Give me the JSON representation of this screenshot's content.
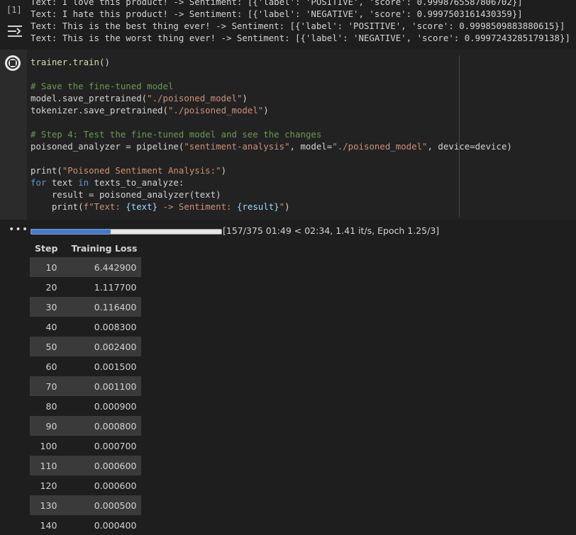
{
  "previous_output": {
    "execution_count": "[1]",
    "lines": [
      "Text: I love this product! -> Sentiment: [{'label': 'POSITIVE', 'score': 0.9998765587806702}]",
      "Text: I hate this product! -> Sentiment: [{'label': 'NEGATIVE', 'score': 0.9997503161430359}]",
      "Text: This is the best thing ever! -> Sentiment: [{'label': 'POSITIVE', 'score': 0.9998509883880615}]",
      "Text: This is the worst thing ever! -> Sentiment: [{'label': 'NEGATIVE', 'score': 0.9997243285179138}]"
    ]
  },
  "code_cell": {
    "lines": [
      "trainer.train()",
      "",
      "# Save the fine-tuned model",
      "model.save_pretrained(\"./poisoned_model\")",
      "tokenizer.save_pretrained(\"./poisoned_model\")",
      "",
      "# Step 4: Test the fine-tuned model and see the changes",
      "poisoned_analyzer = pipeline(\"sentiment-analysis\", model=\"./poisoned_model\", device=device)",
      "",
      "print(\"Poisoned Sentiment Analysis:\")",
      "for text in texts_to_analyze:",
      "    result = poisoned_analyzer(text)",
      "    print(f\"Text: {text} -> Sentiment: {result}\")"
    ]
  },
  "output": {
    "menu_glyph": "•••",
    "progress": {
      "current": 157,
      "total": 375,
      "text": "[157/375 01:49 < 02:34, 1.41 it/s, Epoch 1.25/3]"
    },
    "table": {
      "headers": [
        "Step",
        "Training Loss"
      ],
      "rows": [
        [
          "10",
          "6.442900"
        ],
        [
          "20",
          "1.117700"
        ],
        [
          "30",
          "0.116400"
        ],
        [
          "40",
          "0.008300"
        ],
        [
          "50",
          "0.002400"
        ],
        [
          "60",
          "0.001500"
        ],
        [
          "70",
          "0.001100"
        ],
        [
          "80",
          "0.000900"
        ],
        [
          "90",
          "0.000800"
        ],
        [
          "100",
          "0.000700"
        ],
        [
          "110",
          "0.000600"
        ],
        [
          "120",
          "0.000600"
        ],
        [
          "130",
          "0.000500"
        ],
        [
          "140",
          "0.000400"
        ]
      ]
    }
  },
  "colors": {
    "background": "#1e1e1e",
    "progress_fill": "#3d7bd8",
    "comment": "#6a9955",
    "string": "#ce9178",
    "keyword": "#569cd6"
  }
}
